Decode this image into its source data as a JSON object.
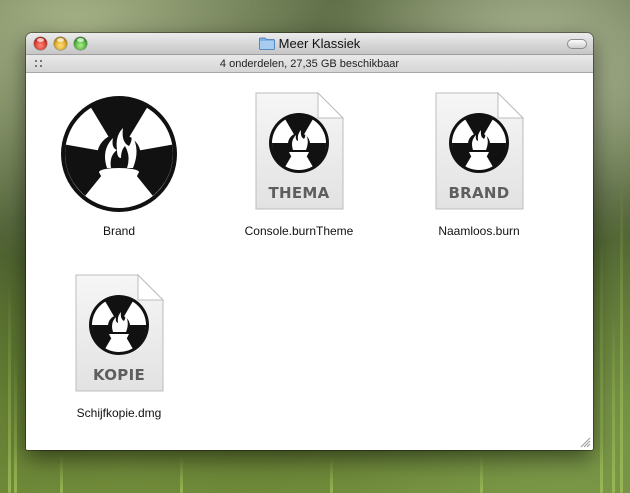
{
  "window": {
    "title": "Meer Klassiek",
    "status": "4 onderdelen, 27,35 GB beschikbaar"
  },
  "items": [
    {
      "label": "Brand",
      "kind": "application",
      "badge": ""
    },
    {
      "label": "Console.burnTheme",
      "kind": "document",
      "badge": "THEMA"
    },
    {
      "label": "Naamloos.burn",
      "kind": "document",
      "badge": "BRAND"
    },
    {
      "label": "Schijfkopie.dmg",
      "kind": "document",
      "badge": "KOPIE"
    }
  ],
  "colors": {
    "close": "#d0281b",
    "minimize": "#d39b12",
    "zoom": "#36a32a",
    "folder": "#7fb2e5"
  }
}
